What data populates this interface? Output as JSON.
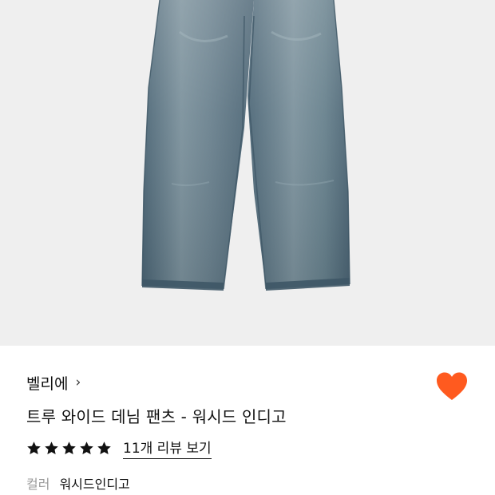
{
  "product": {
    "image_alt": "트루 와이드 데님 팬츠 - 워시드 인디고",
    "brand": "벨리에",
    "brand_chevron": "›",
    "title": "트루 와이드 데님 팬츠 - 워시드 인디고",
    "wishlist_liked": true,
    "rating": {
      "stars": 5,
      "max_stars": 5,
      "review_link": "11개 리뷰 보기"
    },
    "color": {
      "label": "컬러",
      "value": "워시드인디고"
    }
  },
  "colors": {
    "heart": "#ff5a1f",
    "star": "#111111",
    "image_bg": "#efefef",
    "denim": "#5a7282"
  },
  "icons": {
    "wishlist": "heart-icon",
    "brand_chevron": "chevron-right-icon",
    "rating_star": "star-icon"
  }
}
